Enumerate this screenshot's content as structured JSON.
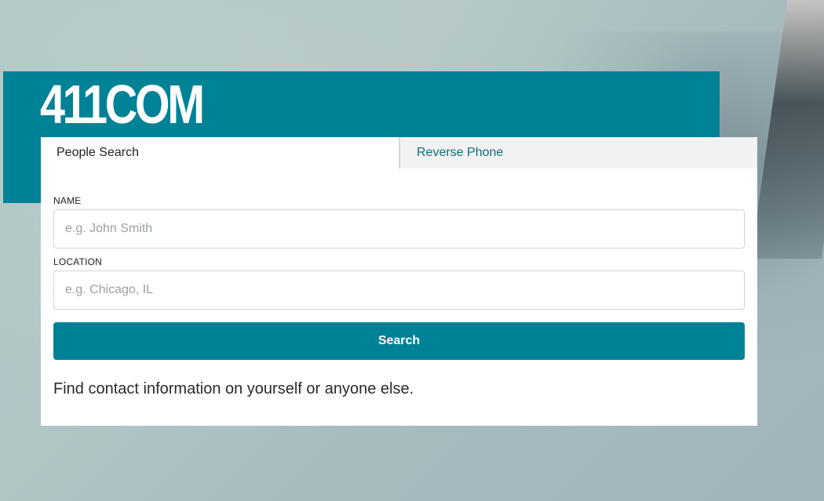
{
  "brand": {
    "logo_text": "411COM",
    "accent_color": "#008296"
  },
  "tabs": [
    {
      "label": "People Search",
      "active": true
    },
    {
      "label": "Reverse Phone",
      "active": false
    }
  ],
  "form": {
    "name_label": "NAME",
    "name_placeholder": "e.g. John Smith",
    "name_value": "",
    "location_label": "LOCATION",
    "location_placeholder": "e.g. Chicago, IL",
    "location_value": "",
    "search_label": "Search"
  },
  "tagline": "Find contact information on yourself or anyone else."
}
